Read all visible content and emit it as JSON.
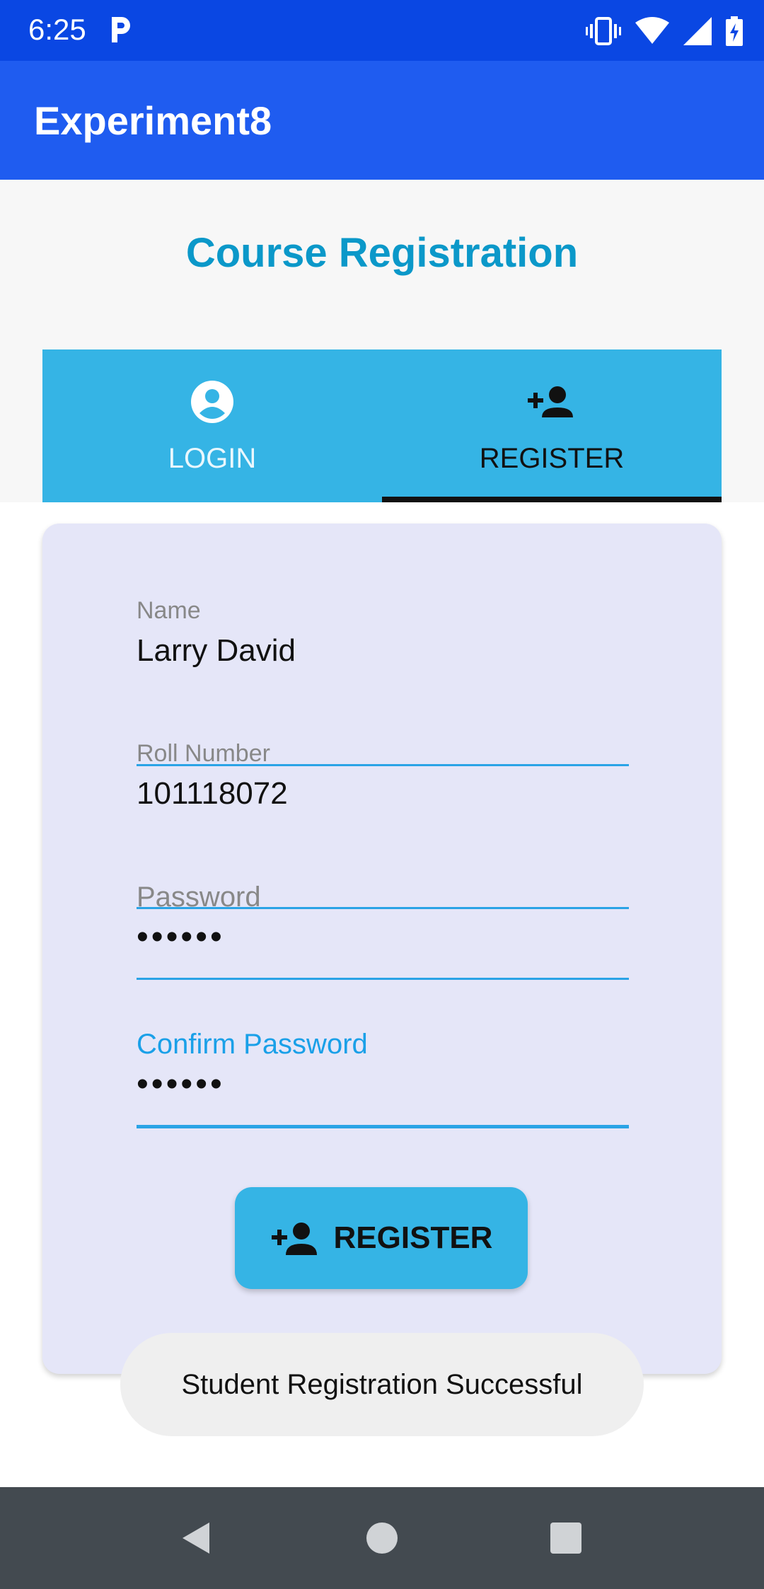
{
  "status_bar": {
    "time": "6:25",
    "icons": [
      "p-icon",
      "vibrate-icon",
      "wifi-icon",
      "signal-icon",
      "battery-charging-icon"
    ]
  },
  "app_bar": {
    "title": "Experiment8"
  },
  "page": {
    "title": "Course Registration"
  },
  "tabs": [
    {
      "label": "LOGIN",
      "icon": "account-circle-icon",
      "selected": false
    },
    {
      "label": "REGISTER",
      "icon": "person-add-icon",
      "selected": true
    }
  ],
  "form": {
    "name": {
      "label": "Name",
      "value": "Larry David"
    },
    "roll_number": {
      "label": "Roll Number",
      "value": "101118072"
    },
    "password": {
      "label": "Password",
      "value": "••••••"
    },
    "confirm_password": {
      "label": "Confirm Password",
      "value": "••••••"
    },
    "register_button": {
      "label": "REGISTER",
      "icon": "person-add-icon"
    }
  },
  "toast": {
    "text": "Student Registration Successful"
  },
  "nav_bar": {
    "buttons": [
      "back-icon",
      "home-icon",
      "recents-icon"
    ]
  },
  "colors": {
    "status_bar": "#0a47e3",
    "app_bar": "#1f5cf0",
    "accent": "#35b4e5",
    "title": "#0b98c9",
    "card": "#e5e6f8",
    "nav_bar": "#434a50"
  }
}
